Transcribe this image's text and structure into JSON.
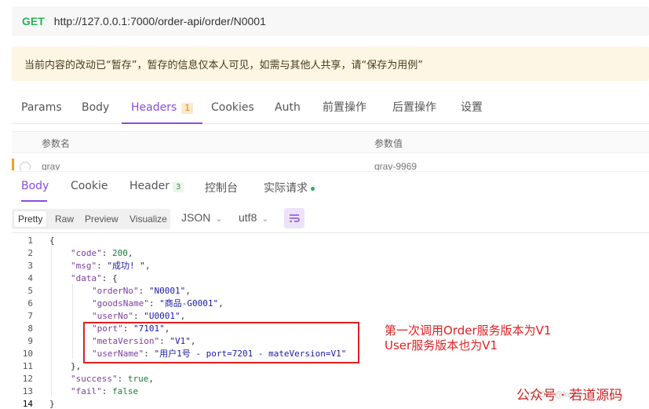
{
  "request": {
    "method": "GET",
    "url": "http://127.0.0.1:7000/order-api/order/N0001"
  },
  "notice": "当前内容的改动已“暂存”，暂存的信息仅本人可见，如需与其他人共享，请“保存为用例”",
  "req_tabs": [
    {
      "label": "Params"
    },
    {
      "label": "Body"
    },
    {
      "label": "Headers",
      "badge": "1"
    },
    {
      "label": "Cookies"
    },
    {
      "label": "Auth"
    },
    {
      "label": "前置操作"
    },
    {
      "label": "后置操作"
    },
    {
      "label": "设置"
    }
  ],
  "params": {
    "col_name": "参数名",
    "col_value": "参数值",
    "rows": [
      {
        "name": "gray",
        "value": "gray-9969"
      }
    ]
  },
  "resp_tabs": [
    {
      "label": "Body"
    },
    {
      "label": "Cookie"
    },
    {
      "label": "Header",
      "badge": "3"
    },
    {
      "label": "控制台"
    },
    {
      "label": "实际请求"
    }
  ],
  "view_modes": [
    "Pretty",
    "Raw",
    "Preview",
    "Visualize"
  ],
  "format": {
    "type": "JSON",
    "encoding": "utf8"
  },
  "code_lines": [
    {
      "n": "1",
      "parts": [
        [
          "p",
          "{"
        ]
      ]
    },
    {
      "n": "2",
      "parts": [
        [
          "k",
          "\"code\""
        ],
        [
          "p",
          ": "
        ],
        [
          "n",
          "200"
        ],
        [
          "p",
          ","
        ]
      ]
    },
    {
      "n": "3",
      "parts": [
        [
          "k",
          "\"msg\""
        ],
        [
          "p",
          ": "
        ],
        [
          "s",
          "\"成功! \""
        ],
        [
          "p",
          ","
        ]
      ]
    },
    {
      "n": "4",
      "parts": [
        [
          "k",
          "\"data\""
        ],
        [
          "p",
          ": {"
        ]
      ]
    },
    {
      "n": "5",
      "parts": [
        [
          "k",
          "\"orderNo\""
        ],
        [
          "p",
          ": "
        ],
        [
          "s",
          "\"N0001\""
        ],
        [
          "p",
          ","
        ]
      ]
    },
    {
      "n": "6",
      "parts": [
        [
          "k",
          "\"goodsName\""
        ],
        [
          "p",
          ": "
        ],
        [
          "s",
          "\"商品-G0001\""
        ],
        [
          "p",
          ","
        ]
      ]
    },
    {
      "n": "7",
      "parts": [
        [
          "k",
          "\"userNo\""
        ],
        [
          "p",
          ": "
        ],
        [
          "s",
          "\"U0001\""
        ],
        [
          "p",
          ","
        ]
      ]
    },
    {
      "n": "8",
      "parts": [
        [
          "k",
          "\"port\""
        ],
        [
          "p",
          ": "
        ],
        [
          "s",
          "\"7101\""
        ],
        [
          "p",
          ","
        ]
      ]
    },
    {
      "n": "9",
      "parts": [
        [
          "k",
          "\"metaVersion\""
        ],
        [
          "p",
          ": "
        ],
        [
          "s",
          "\"V1\""
        ],
        [
          "p",
          ","
        ]
      ]
    },
    {
      "n": "10",
      "parts": [
        [
          "k",
          "\"userName\""
        ],
        [
          "p",
          ": "
        ],
        [
          "s",
          "\"用户1号 - port=7201 - mateVersion=V1\""
        ]
      ]
    },
    {
      "n": "11",
      "parts": [
        [
          "p",
          "},"
        ]
      ]
    },
    {
      "n": "12",
      "parts": [
        [
          "k",
          "\"success\""
        ],
        [
          "p",
          ": "
        ],
        [
          "n",
          "true"
        ],
        [
          "p",
          ","
        ]
      ]
    },
    {
      "n": "13",
      "parts": [
        [
          "k",
          "\"fail\""
        ],
        [
          "p",
          ": "
        ],
        [
          "n",
          "false"
        ]
      ]
    },
    {
      "n": "14",
      "parts": [
        [
          "p",
          "}"
        ]
      ]
    }
  ],
  "annotation": {
    "line1": "第一次调用Order服务版本为V1",
    "line2": "User服务版本也为V1"
  },
  "watermark": {
    "text": "公众号 · 若道源码",
    "faint": "CSDN @kewe"
  },
  "colors": {
    "accent": "#8a4dd9",
    "get": "#2bb05a",
    "annotation": "#e02020"
  }
}
